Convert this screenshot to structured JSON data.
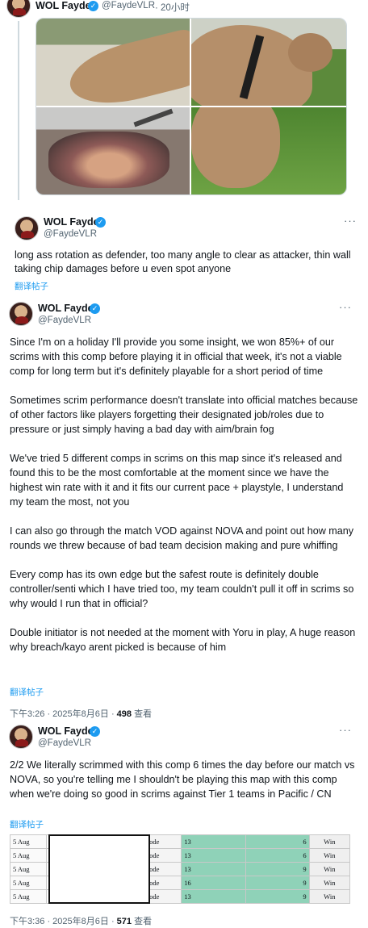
{
  "tweets": [
    {
      "name": "WOL Fayde",
      "handle": "@FaydeVLR",
      "time": "· 20小时"
    },
    {
      "name": "WOL Fayde",
      "handle": "@FaydeVLR",
      "text": "long ass rotation as defender, too many angle to clear as attacker, thin wall taking chip damages before u even spot anyone",
      "translate": "翻译帖子"
    },
    {
      "name": "WOL Fayde",
      "handle": "@FaydeVLR",
      "paragraphs": [
        "Since I'm on a holiday I'll provide you some insight, we won 85%+ of our scrims with this comp before playing it in official that week, it's not a viable comp for long term but it's definitely playable for a short period of time",
        "Sometimes scrim performance doesn't translate into official matches because of other factors like players forgetting their designated job/roles due to pressure or just simply having a bad day with aim/brain fog",
        "We've tried 5 different comps in scrims on this map since it's released and found this to be the most comfortable at the moment since we have the highest win rate with it and it fits our current pace + playstyle, I understand my team the most, not you",
        "I can also go through the match VOD against NOVA and point out how many rounds we threw because of bad team decision making and pure whiffing",
        "Every comp has its own edge but the safest route is definitely double controller/senti which I have tried too, my team couldn't pull it off in scrims so why would I run that in official?",
        "Double initiator is not needed at the moment with Yoru in play, A huge reason why breach/kayo arent picked is because of him"
      ],
      "translate": "翻译帖子",
      "timestamp": "下午3:26 · 2025年8月6日 · ",
      "views": "498",
      "views_label": " 查看"
    },
    {
      "name": "WOL Fayde",
      "handle": "@FaydeVLR",
      "text": "2/2 We literally scrimmed with this comp 6 times the day before our match vs NOVA, so you're telling me I shouldn't be playing this map with this comp when we're doing so good in scrims against Tier 1 teams in Pacific / CN",
      "translate": "翻译帖子",
      "timestamp": "下午3:36 · 2025年8月6日 · ",
      "views": "571",
      "views_label": " 查看"
    }
  ],
  "scrim_table": {
    "rows": [
      {
        "date": "5 Aug",
        "map": "Corrode",
        "score1": "13",
        "score2": "6",
        "result": "Win"
      },
      {
        "date": "5 Aug",
        "map": "Corrode",
        "score1": "13",
        "score2": "6",
        "result": "Win"
      },
      {
        "date": "5 Aug",
        "map": "Corrode",
        "score1": "13",
        "score2": "9",
        "result": "Win"
      },
      {
        "date": "5 Aug",
        "map": "Corrode",
        "score1": "16",
        "score2": "9",
        "result": "Win"
      },
      {
        "date": "5 Aug",
        "map": "Corrode",
        "score1": "13",
        "score2": "9",
        "result": "Win"
      }
    ]
  },
  "colors": {
    "accent": "#1d9bf0",
    "muted": "#536471",
    "score_fill": "#8fd2b8"
  }
}
